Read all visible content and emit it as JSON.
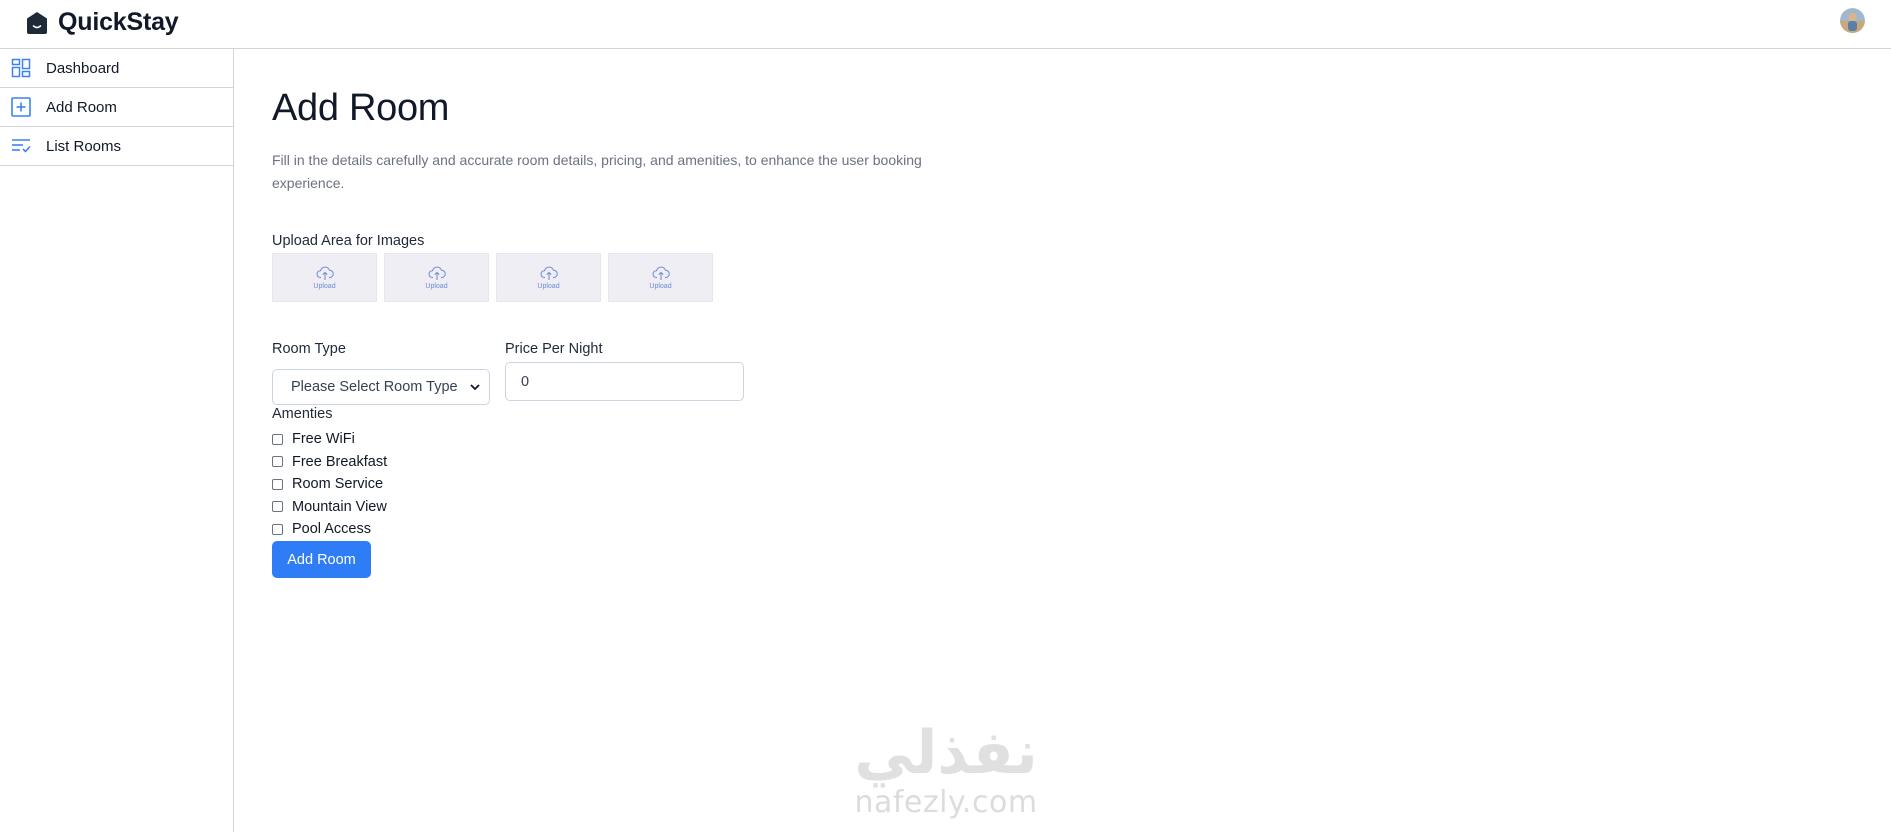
{
  "app": {
    "brand_name": "QuickStay",
    "brand_icon": "house-smile-icon",
    "avatar_icon": "user-avatar"
  },
  "sidebar": {
    "items": [
      {
        "label": "Dashboard",
        "icon": "dashboard-grid-icon"
      },
      {
        "label": "Add Room",
        "icon": "add-square-icon",
        "active": true
      },
      {
        "label": "List Rooms",
        "icon": "list-check-icon"
      }
    ]
  },
  "main": {
    "title": "Add Room",
    "description": "Fill in the details carefully and accurate room details, pricing, and amenities, to enhance the user booking experience.",
    "upload": {
      "label": "Upload Area for Images",
      "boxes": [
        {
          "text": "Upload"
        },
        {
          "text": "Upload"
        },
        {
          "text": "Upload"
        },
        {
          "text": "Upload"
        }
      ]
    },
    "room_type": {
      "label": "Room Type",
      "selected": "Please Select Room Type"
    },
    "price": {
      "label": "Price Per Night",
      "value": "0"
    },
    "amenities": {
      "label": "Amenties",
      "items": [
        "Free WiFi",
        "Free Breakfast",
        "Room Service",
        "Mountain View",
        "Pool Access"
      ]
    },
    "submit_label": "Add Room"
  },
  "watermark": {
    "arabic": "نفذلي",
    "latin": "nafezly.com"
  },
  "colors": {
    "accent": "#2f7df6",
    "icon_blue": "#3b82f6",
    "border": "#d1d5db",
    "upload_bg": "#eeeef4"
  }
}
